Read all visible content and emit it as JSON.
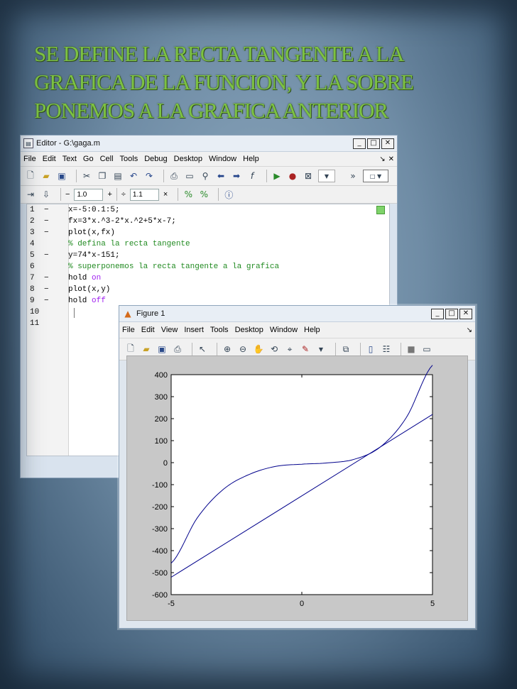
{
  "slide": {
    "title_lines": [
      "SE DEFINE LA RECTA TANGENTE A LA",
      "GRAFICA DE LA FUNCION, Y LA SOBRE",
      "PONEMOS A LA GRAFICA ANTERIOR"
    ],
    "title_color": "#7dc242"
  },
  "editor": {
    "title": "Editor - G:\\gaga.m",
    "menu": [
      "File",
      "Edit",
      "Text",
      "Go",
      "Cell",
      "Tools",
      "Debug",
      "Desktop",
      "Window",
      "Help"
    ],
    "cell_toolbar": {
      "minus": "−",
      "field1": "1.0",
      "plus": "+",
      "divide": "÷",
      "field2": "1.1",
      "times": "×"
    },
    "lines": [
      {
        "n": "1",
        "dash": "−",
        "parts": [
          {
            "t": "x=-5:0.1:5;",
            "c": "normal"
          }
        ]
      },
      {
        "n": "2",
        "dash": "−",
        "parts": [
          {
            "t": "fx=3*x.^3-2*x.^2+5*x-7;",
            "c": "normal"
          }
        ]
      },
      {
        "n": "3",
        "dash": "−",
        "parts": [
          {
            "t": "plot(x,fx)",
            "c": "normal"
          }
        ]
      },
      {
        "n": "4",
        "dash": "",
        "parts": [
          {
            "t": "% defina la recta tangente",
            "c": "comment"
          }
        ]
      },
      {
        "n": "5",
        "dash": "−",
        "parts": [
          {
            "t": "y=74*x-151;",
            "c": "normal"
          }
        ]
      },
      {
        "n": "6",
        "dash": "",
        "parts": [
          {
            "t": "% superponemos la recta tangente a la grafica",
            "c": "comment"
          }
        ]
      },
      {
        "n": "7",
        "dash": "−",
        "parts": [
          {
            "t": "hold ",
            "c": "normal"
          },
          {
            "t": "on",
            "c": "purple"
          }
        ]
      },
      {
        "n": "8",
        "dash": "−",
        "parts": [
          {
            "t": "plot(x,y)",
            "c": "normal"
          }
        ]
      },
      {
        "n": "9",
        "dash": "−",
        "parts": [
          {
            "t": "hold ",
            "c": "normal"
          },
          {
            "t": "off",
            "c": "purple"
          }
        ]
      },
      {
        "n": "10",
        "dash": "",
        "parts": []
      },
      {
        "n": "11",
        "dash": "",
        "parts": []
      }
    ]
  },
  "figure": {
    "title": "Figure 1",
    "menu": [
      "File",
      "Edit",
      "View",
      "Insert",
      "Tools",
      "Desktop",
      "Window",
      "Help"
    ],
    "curve_color": "#00008b"
  },
  "chart_data": {
    "type": "line",
    "xlim": [
      -5,
      5
    ],
    "ylim": [
      -600,
      400
    ],
    "x_ticks": [
      -5,
      0,
      5
    ],
    "y_ticks": [
      400,
      300,
      200,
      100,
      0,
      -100,
      -200,
      -300,
      -400,
      -500,
      -600
    ],
    "grid": false,
    "series": [
      {
        "formula": "3x^3-2x^2+5x-7",
        "x": [
          -5,
          -4,
          -3,
          -2,
          -1,
          0,
          1,
          2,
          3,
          4,
          5
        ],
        "values": [
          -457,
          -251,
          -121,
          -53,
          -17,
          -7,
          -1,
          15,
          71,
          205,
          443
        ]
      },
      {
        "formula": "74x-151",
        "x": [
          -5,
          5
        ],
        "values": [
          -521,
          219
        ]
      }
    ]
  }
}
